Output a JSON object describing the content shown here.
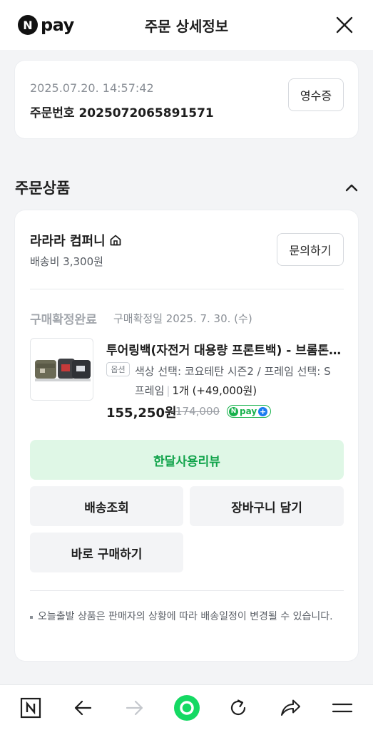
{
  "header": {
    "logo_n": "N",
    "logo_text": "pay",
    "title": "주문 상세정보",
    "close_icon": "close-icon"
  },
  "order": {
    "datetime": "2025.07.20. 14:57:42",
    "order_number": "주문번호 2025072065891571",
    "receipt_label": "영수증"
  },
  "section": {
    "title": "주문상품",
    "toggle_icon": "chevron-up-icon"
  },
  "seller": {
    "name": "라라라 컴퍼니",
    "shipping_fee": "배송비 3,300원",
    "inquiry_label": "문의하기"
  },
  "item": {
    "status": "구매확정완료",
    "status_date": "구매확정일 2025. 7. 30. (수)",
    "name": "투어링백(자전거 대용량 프론트백) - 브롬톤 프레임",
    "option_badge": "옵션",
    "option_text": "색상 선택: 코요테탄 시즌2 / 프레임 선택: S 프레임",
    "quantity": "1개 (+49,000원)",
    "price": "155,250원",
    "original_price": "174,000",
    "npay_n": "N",
    "npay_text": "pay",
    "npay_plus": "+"
  },
  "actions": {
    "review": "한달사용리뷰",
    "track": "배송조회",
    "cart": "장바구니 담기",
    "buy": "바로 구매하기"
  },
  "notice": "오늘출발 상품은 판매자의 상황에 따라 배송일정이 변경될 수 있습니다.",
  "bottom_nav": [
    {
      "icon": "naver-home-icon"
    },
    {
      "icon": "back-arrow-icon"
    },
    {
      "icon": "forward-arrow-icon"
    },
    {
      "icon": "green-dot-icon"
    },
    {
      "icon": "refresh-icon"
    },
    {
      "icon": "share-icon"
    },
    {
      "icon": "menu-icon"
    }
  ],
  "colors": {
    "accent_green": "#10a34a",
    "review_bg": "#dff7e6",
    "npay_green": "#17b24c",
    "npay_blue": "#1a7cf0",
    "status_gray": "#a2a6ac",
    "nav_green": "#15d963"
  }
}
